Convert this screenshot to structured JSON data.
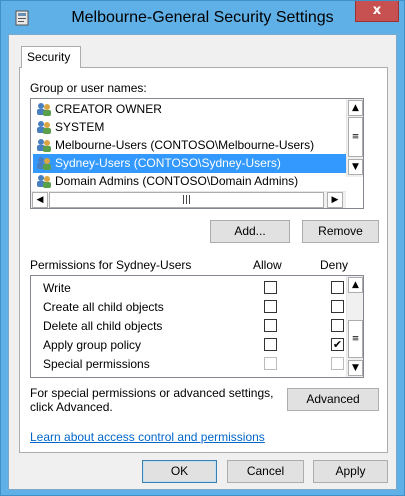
{
  "window": {
    "title": "Melbourne-General Security Settings",
    "close_label": "x"
  },
  "tabs": [
    {
      "label": "Security",
      "selected": true
    }
  ],
  "group_section": {
    "label": "Group or user names:",
    "users": [
      {
        "name": "CREATOR OWNER",
        "icon": "users-group-icon",
        "selected": false
      },
      {
        "name": "SYSTEM",
        "icon": "users-group-icon",
        "selected": false
      },
      {
        "name": "Melbourne-Users (CONTOSO\\Melbourne-Users)",
        "icon": "users-group-icon",
        "selected": false
      },
      {
        "name": "Sydney-Users (CONTOSO\\Sydney-Users)",
        "icon": "users-group-icon",
        "selected": true
      },
      {
        "name": "Domain Admins (CONTOSO\\Domain Admins)",
        "icon": "users-group-icon",
        "selected": false
      }
    ],
    "add_label": "Add...",
    "remove_label": "Remove"
  },
  "permissions": {
    "header": "Permissions for Sydney-Users",
    "allow_header": "Allow",
    "deny_header": "Deny",
    "rows": [
      {
        "name": "Write",
        "allow": false,
        "deny": false,
        "allow_enabled": true,
        "deny_enabled": true
      },
      {
        "name": "Create all child objects",
        "allow": false,
        "deny": false,
        "allow_enabled": true,
        "deny_enabled": true
      },
      {
        "name": "Delete all child objects",
        "allow": false,
        "deny": false,
        "allow_enabled": true,
        "deny_enabled": true
      },
      {
        "name": "Apply group policy",
        "allow": false,
        "deny": true,
        "allow_enabled": true,
        "deny_enabled": true
      },
      {
        "name": "Special permissions",
        "allow": false,
        "deny": false,
        "allow_enabled": false,
        "deny_enabled": false
      }
    ]
  },
  "advanced": {
    "text_line1": "For special permissions or advanced settings,",
    "text_line2": "click Advanced.",
    "button_label": "Advanced"
  },
  "help_link": "Learn about access control and permissions",
  "footer": {
    "ok_label": "OK",
    "cancel_label": "Cancel",
    "apply_label": "Apply"
  },
  "colors": {
    "titlebar": "#5fb0e6",
    "close": "#c75050",
    "selection": "#3399ff",
    "link": "#0066cc"
  }
}
